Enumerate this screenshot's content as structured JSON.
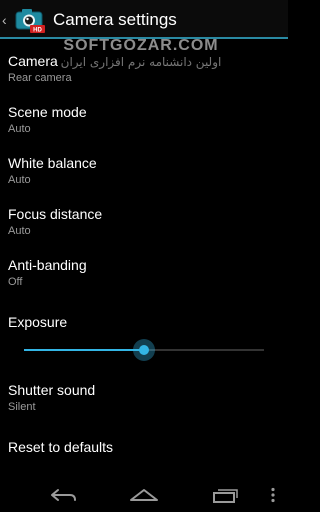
{
  "header": {
    "title": "Camera settings",
    "back_glyph": "‹",
    "icon": "camera-app-icon"
  },
  "watermark": {
    "latin": "SOFTGOZAR.COM",
    "persian": "اولین دانشنامه نرم افزاری ایران"
  },
  "settings": [
    {
      "label": "Camera",
      "value": "Rear camera"
    },
    {
      "label": "Scene mode",
      "value": "Auto"
    },
    {
      "label": "White balance",
      "value": "Auto"
    },
    {
      "label": "Focus distance",
      "value": "Auto"
    },
    {
      "label": "Anti-banding",
      "value": "Off"
    }
  ],
  "exposure": {
    "label": "Exposure",
    "level": 0.5
  },
  "shutter": {
    "label": "Shutter sound",
    "value": "Silent"
  },
  "reset": {
    "label": "Reset to defaults"
  },
  "navbar": {
    "back": "back-icon",
    "home": "home-icon",
    "recents": "recents-icon",
    "menu": "overflow-menu-icon"
  },
  "colors": {
    "accent": "#33b5e5",
    "divider": "#2a8aa3",
    "secondary_text": "#9a9a9a"
  }
}
